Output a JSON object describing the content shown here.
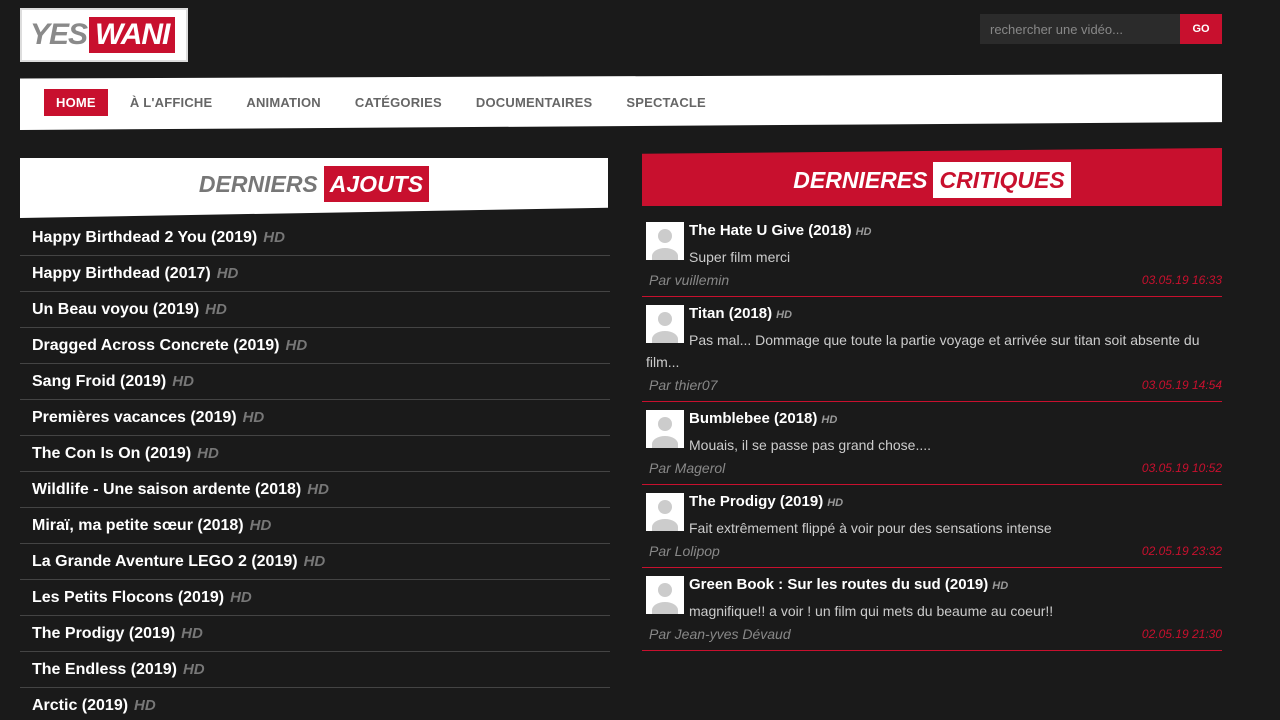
{
  "logo": {
    "part1": "YES",
    "part2": "WANI"
  },
  "search": {
    "placeholder": "rechercher une vidéo...",
    "button_label": "GO"
  },
  "nav": {
    "items": [
      {
        "label": "HOME"
      },
      {
        "label": "À L'AFFICHE"
      },
      {
        "label": "ANIMATION"
      },
      {
        "label": "CATÉGORIES"
      },
      {
        "label": "DOCUMENTAIRES"
      },
      {
        "label": "SPECTACLE"
      }
    ]
  },
  "left": {
    "title_word1": "DERNIERS",
    "title_word2": "AJOUTS",
    "movies": [
      {
        "title": "Happy Birthdead 2 You (2019)",
        "badge": "HD"
      },
      {
        "title": "Happy Birthdead (2017)",
        "badge": "HD"
      },
      {
        "title": "Un Beau voyou (2019)",
        "badge": "HD"
      },
      {
        "title": "Dragged Across Concrete (2019)",
        "badge": "HD"
      },
      {
        "title": "Sang Froid (2019)",
        "badge": "HD"
      },
      {
        "title": "Premières vacances (2019)",
        "badge": "HD"
      },
      {
        "title": "The Con Is On (2019)",
        "badge": "HD"
      },
      {
        "title": "Wildlife - Une saison ardente (2018)",
        "badge": "HD"
      },
      {
        "title": "Miraï, ma petite sœur (2018)",
        "badge": "HD"
      },
      {
        "title": "La Grande Aventure LEGO 2 (2019)",
        "badge": "HD"
      },
      {
        "title": "Les Petits Flocons (2019)",
        "badge": "HD"
      },
      {
        "title": "The Prodigy (2019)",
        "badge": "HD"
      },
      {
        "title": "The Endless (2019)",
        "badge": "HD"
      },
      {
        "title": "Arctic (2019)",
        "badge": "HD"
      }
    ]
  },
  "right": {
    "title_word1": "DERNIERES",
    "title_word2": "CRITIQUES",
    "reviews": [
      {
        "title": "The Hate U Give (2018)",
        "badge": "HD",
        "text": "Super film merci",
        "author": "Par vuillemin",
        "date": "03.05.19 16:33"
      },
      {
        "title": "Titan (2018)",
        "badge": "HD",
        "text": "Pas mal... Dommage que toute la partie voyage et arrivée sur titan soit absente du film...",
        "author": "Par thier07",
        "date": "03.05.19 14:54"
      },
      {
        "title": "Bumblebee (2018)",
        "badge": "HD",
        "text": "Mouais, il se passe pas grand chose....",
        "author": "Par Magerol",
        "date": "03.05.19 10:52"
      },
      {
        "title": "The Prodigy (2019)",
        "badge": "HD",
        "text": "Fait extrêmement flippé à voir pour des sensations intense",
        "author": "Par Lolipop",
        "date": "02.05.19 23:32"
      },
      {
        "title": "Green Book : Sur les routes du sud (2019)",
        "badge": "HD",
        "text": "magnifique!! a voir ! un film qui mets du beaume au coeur!!",
        "author": "Par Jean-yves Dévaud",
        "date": "02.05.19 21:30"
      }
    ]
  },
  "colors": {
    "accent": "#c8102e",
    "background": "#1a1a1a"
  }
}
